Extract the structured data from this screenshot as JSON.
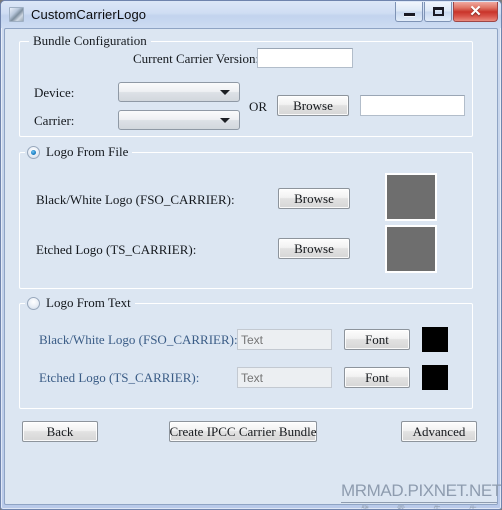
{
  "window": {
    "title": "CustomCarrierLogo",
    "icon": "app-gradient-icon",
    "buttons": {
      "minimize": "–",
      "maximize": "□",
      "close": "✕"
    }
  },
  "bundle": {
    "legend": "Bundle Configuration",
    "carrier_version_label": "Current Carrier Version:",
    "carrier_version_value": "",
    "carrier_version_placeholder": "",
    "device_label": "Device:",
    "device_value": "",
    "carrier_label": "Carrier:",
    "carrier_value": "",
    "or_label": "OR",
    "browse_label": "Browse",
    "bundle_path_value": "",
    "bundle_path_placeholder": ""
  },
  "logo_from_file": {
    "legend": "Logo From File",
    "selected": true,
    "bw_label": "Black/White Logo  (FSO_CARRIER):",
    "bw_browse_label": "Browse",
    "bw_preview_color": "#6e6e6e",
    "etched_label": "Etched Logo (TS_CARRIER):",
    "etched_browse_label": "Browse",
    "etched_preview_color": "#6e6e6e"
  },
  "logo_from_text": {
    "legend": "Logo From Text",
    "selected": false,
    "bw_label": "Black/White Logo  (FSO_CARRIER):",
    "bw_text_value": "",
    "bw_text_placeholder": "Text",
    "bw_font_label": "Font",
    "bw_color": "#000000",
    "etched_label": "Etched Logo (TS_CARRIER):",
    "etched_text_value": "",
    "etched_text_placeholder": "Text",
    "etched_font_label": "Font",
    "etched_color": "#000000"
  },
  "actions": {
    "back_label": "Back",
    "create_label": "Create IPCC Carrier Bundle",
    "advanced_label": "Advanced"
  },
  "watermark": {
    "main": "MRMAD.PIXNET.NET",
    "sub": [
      "發",
      "霹",
      "先",
      "生"
    ],
    "color": "#8e9caf"
  }
}
